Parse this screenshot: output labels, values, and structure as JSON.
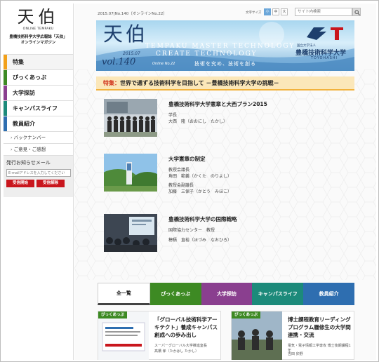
{
  "sidebar": {
    "logo_mark": "天伯",
    "logo_sub": "ONLINE TEMPAKU",
    "tagline_1": "豊橋技術科学大学広報誌「天伯」",
    "tagline_2": "オンラインマガジン",
    "menu": [
      {
        "label": "特集"
      },
      {
        "label": "ぴっくあっぷ"
      },
      {
        "label": "大学探訪"
      },
      {
        "label": "キャンパスライフ"
      },
      {
        "label": "教員紹介"
      }
    ],
    "sub_items": [
      {
        "label": "バックナンバー"
      },
      {
        "label": "ご意見・ご感想"
      }
    ],
    "mail": {
      "title": "発行お知らせメール",
      "placeholder": "E-mailアドレスを入力してください",
      "start_label": "受信開始",
      "stop_label": "受信解除"
    }
  },
  "topbar": {
    "issue": "2015.07|No.140（オンラインNo.22）",
    "fontsize_label": "文字サイズ",
    "fontsize_small": "小",
    "fontsize_medium": "中",
    "fontsize_large": "大",
    "search_placeholder": "サイト内検索"
  },
  "banner": {
    "title": "天伯",
    "tag1": "TEMPAKU  MASTER  TECHNOLOGY",
    "tag2": "CREATE  TECHNOLOGY",
    "year": "2015.07",
    "vol": "vol.140",
    "vol_sub": "Online No.22",
    "slogan": "技術を究め、技術を創る",
    "univ_small": "国立大学法人",
    "univ": "豊橋技術科学大学",
    "univ_en": "TOYOHASHI"
  },
  "feature": {
    "prefix": "特集：",
    "title": "世界で通ずる技術科学を目指して －豊橋技術科学大学の挑戦－"
  },
  "articles": [
    {
      "title": "豊橋技術科学大学憲章と大西プラン2015",
      "lines": [
        "学長",
        "大西　隆（おおにし　たかし）"
      ]
    },
    {
      "title": "大学憲章の制定",
      "lines": [
        "教授会議長",
        "角田　範義（かくた　のりよし）",
        "教授会副議長",
        "加藤　三保子（かとう　みほこ）"
      ]
    },
    {
      "title": "豊橋技術科学大学の国際戦略",
      "lines": [
        "国際協力センター　教授",
        "穂積　直裕（ほづみ　なおひろ）"
      ]
    }
  ],
  "tabs": [
    {
      "label": "全一覧"
    },
    {
      "label": "ぴっくあっぷ"
    },
    {
      "label": "大学探訪"
    },
    {
      "label": "キャンパスライフ"
    },
    {
      "label": "教員紹介"
    }
  ],
  "cards": [
    {
      "badge": "ぴっくあっぷ",
      "title": "「グローバル技術科学アーキテクト」養成キャンパス創成への歩み出し",
      "sub_1": "スーパーグローバル大学推進室長",
      "sub_2": "髙橋 孝（たかはし たかし）"
    },
    {
      "badge": "ぴっくあっぷ",
      "title": "博士課程教育リーディングプログラム履修生の大学間連携・交流",
      "sub_1": "電気・電子情報工学専攻 博士後期課程1年",
      "sub_2": "吉田 卯野"
    }
  ],
  "colors": {
    "orange": "#f2a019",
    "green": "#3d8a23",
    "purple": "#8a3f8f",
    "teal": "#1c8a7a",
    "blue": "#2e6eb0",
    "red": "#c9161d"
  }
}
